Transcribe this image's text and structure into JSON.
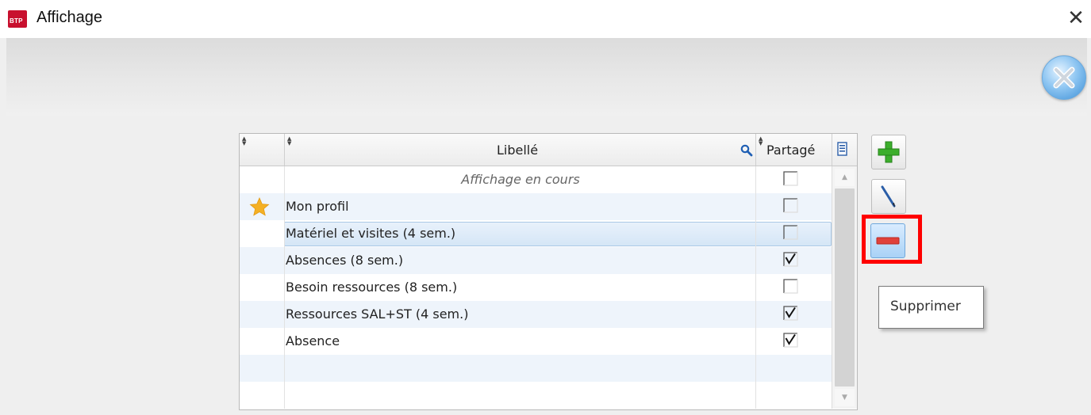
{
  "window": {
    "title": "Affichage",
    "app_icon_text": "BTP",
    "close_glyph": "✕"
  },
  "header": {
    "close_button_icon": "close-circle-icon"
  },
  "grid": {
    "columns": [
      "",
      "Libellé",
      "Partagé"
    ],
    "rows": [
      {
        "label": "Affichage en cours",
        "shared": false,
        "favorite": false,
        "current": true
      },
      {
        "label": "Mon profil",
        "shared": false,
        "favorite": true
      },
      {
        "label": "Matériel et visites (4 sem.)",
        "shared": false,
        "favorite": false,
        "selected": true
      },
      {
        "label": "Absences (8 sem.)",
        "shared": true,
        "favorite": false
      },
      {
        "label": "Besoin ressources (8 sem.)",
        "shared": false,
        "favorite": false
      },
      {
        "label": "Ressources SAL+ST (4 sem.)",
        "shared": true,
        "favorite": false
      },
      {
        "label": "Absence",
        "shared": true,
        "favorite": false
      }
    ]
  },
  "actions": {
    "add_icon": "plus-icon",
    "edit_icon": "pencil-icon",
    "delete_icon": "minus-icon",
    "tooltip": "Supprimer"
  },
  "colors": {
    "highlight": "#ff0000",
    "add_green": "#3cae2c",
    "delete_red": "#e0413a",
    "star": "#f4b024",
    "selection": "#d5e6f6"
  }
}
